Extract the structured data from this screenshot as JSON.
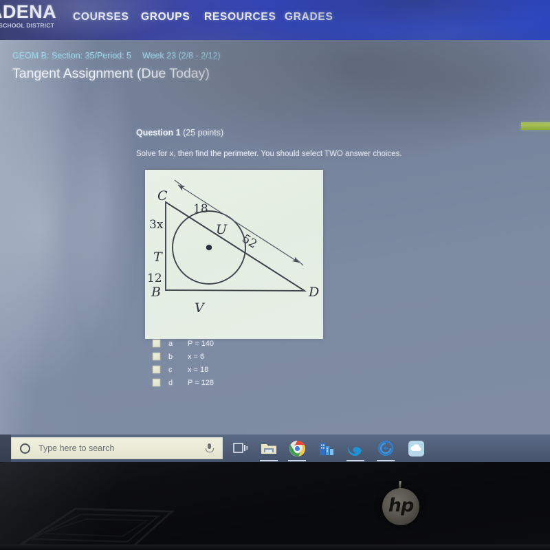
{
  "navbar": {
    "logo_name": "ADENA",
    "logo_sub": "NT SCHOOL DISTRICT",
    "links": [
      {
        "label": "COURSES"
      },
      {
        "label": "GROUPS"
      },
      {
        "label": "RESOURCES"
      },
      {
        "label": "GRADES"
      }
    ],
    "background_color": "#2f46c4"
  },
  "course_header": {
    "course_crumb": "GEOM B: Section: 35/Period: 5",
    "week_crumb": "Week 23 (2/8 - 2/12)",
    "assignment_title": "Tangent Assignment (Due Today)",
    "crumb_color": "#9fd4e8"
  },
  "question": {
    "number_label": "Question 1",
    "points_label": "(25 points)",
    "prompt": "Solve for x, then find the perimeter. You should select TWO answer choices."
  },
  "figure": {
    "background_color": "#e7efe6",
    "vertex_labels": [
      "C",
      "T",
      "B",
      "V",
      "D",
      "U"
    ],
    "side_labels": [
      "3x",
      "12",
      "18",
      "52"
    ],
    "center_point": "circle-center-dot",
    "description_labels": {
      "c": "C",
      "t": "T",
      "b": "B",
      "v": "V",
      "d": "D",
      "u": "U",
      "ct": "3x",
      "tb": "12",
      "cu": "18",
      "cd": "52"
    }
  },
  "answers": {
    "options": [
      {
        "letter": "a",
        "text": "P = 140",
        "checked": false
      },
      {
        "letter": "b",
        "text": "x = 6",
        "checked": false
      },
      {
        "letter": "c",
        "text": "x = 18",
        "checked": false
      },
      {
        "letter": "d",
        "text": "P = 128",
        "checked": false
      }
    ]
  },
  "highlight": {
    "color": "#a0c04e"
  },
  "taskbar": {
    "search_placeholder": "Type here to search",
    "search_icon": "search-circle-icon",
    "mic_icon": "microphone-icon",
    "items": [
      {
        "name": "task-view-icon",
        "label": "Task View"
      },
      {
        "name": "file-explorer-icon",
        "label": "File Explorer"
      },
      {
        "name": "chrome-icon",
        "label": "Google Chrome"
      },
      {
        "name": "store-icon",
        "label": "Microsoft Store"
      },
      {
        "name": "edge-icon",
        "label": "Microsoft Edge"
      },
      {
        "name": "sync-icon",
        "label": "Sync"
      },
      {
        "name": "cloud-icon",
        "label": "Cloud"
      }
    ]
  },
  "device": {
    "brand_logo": "hp"
  }
}
